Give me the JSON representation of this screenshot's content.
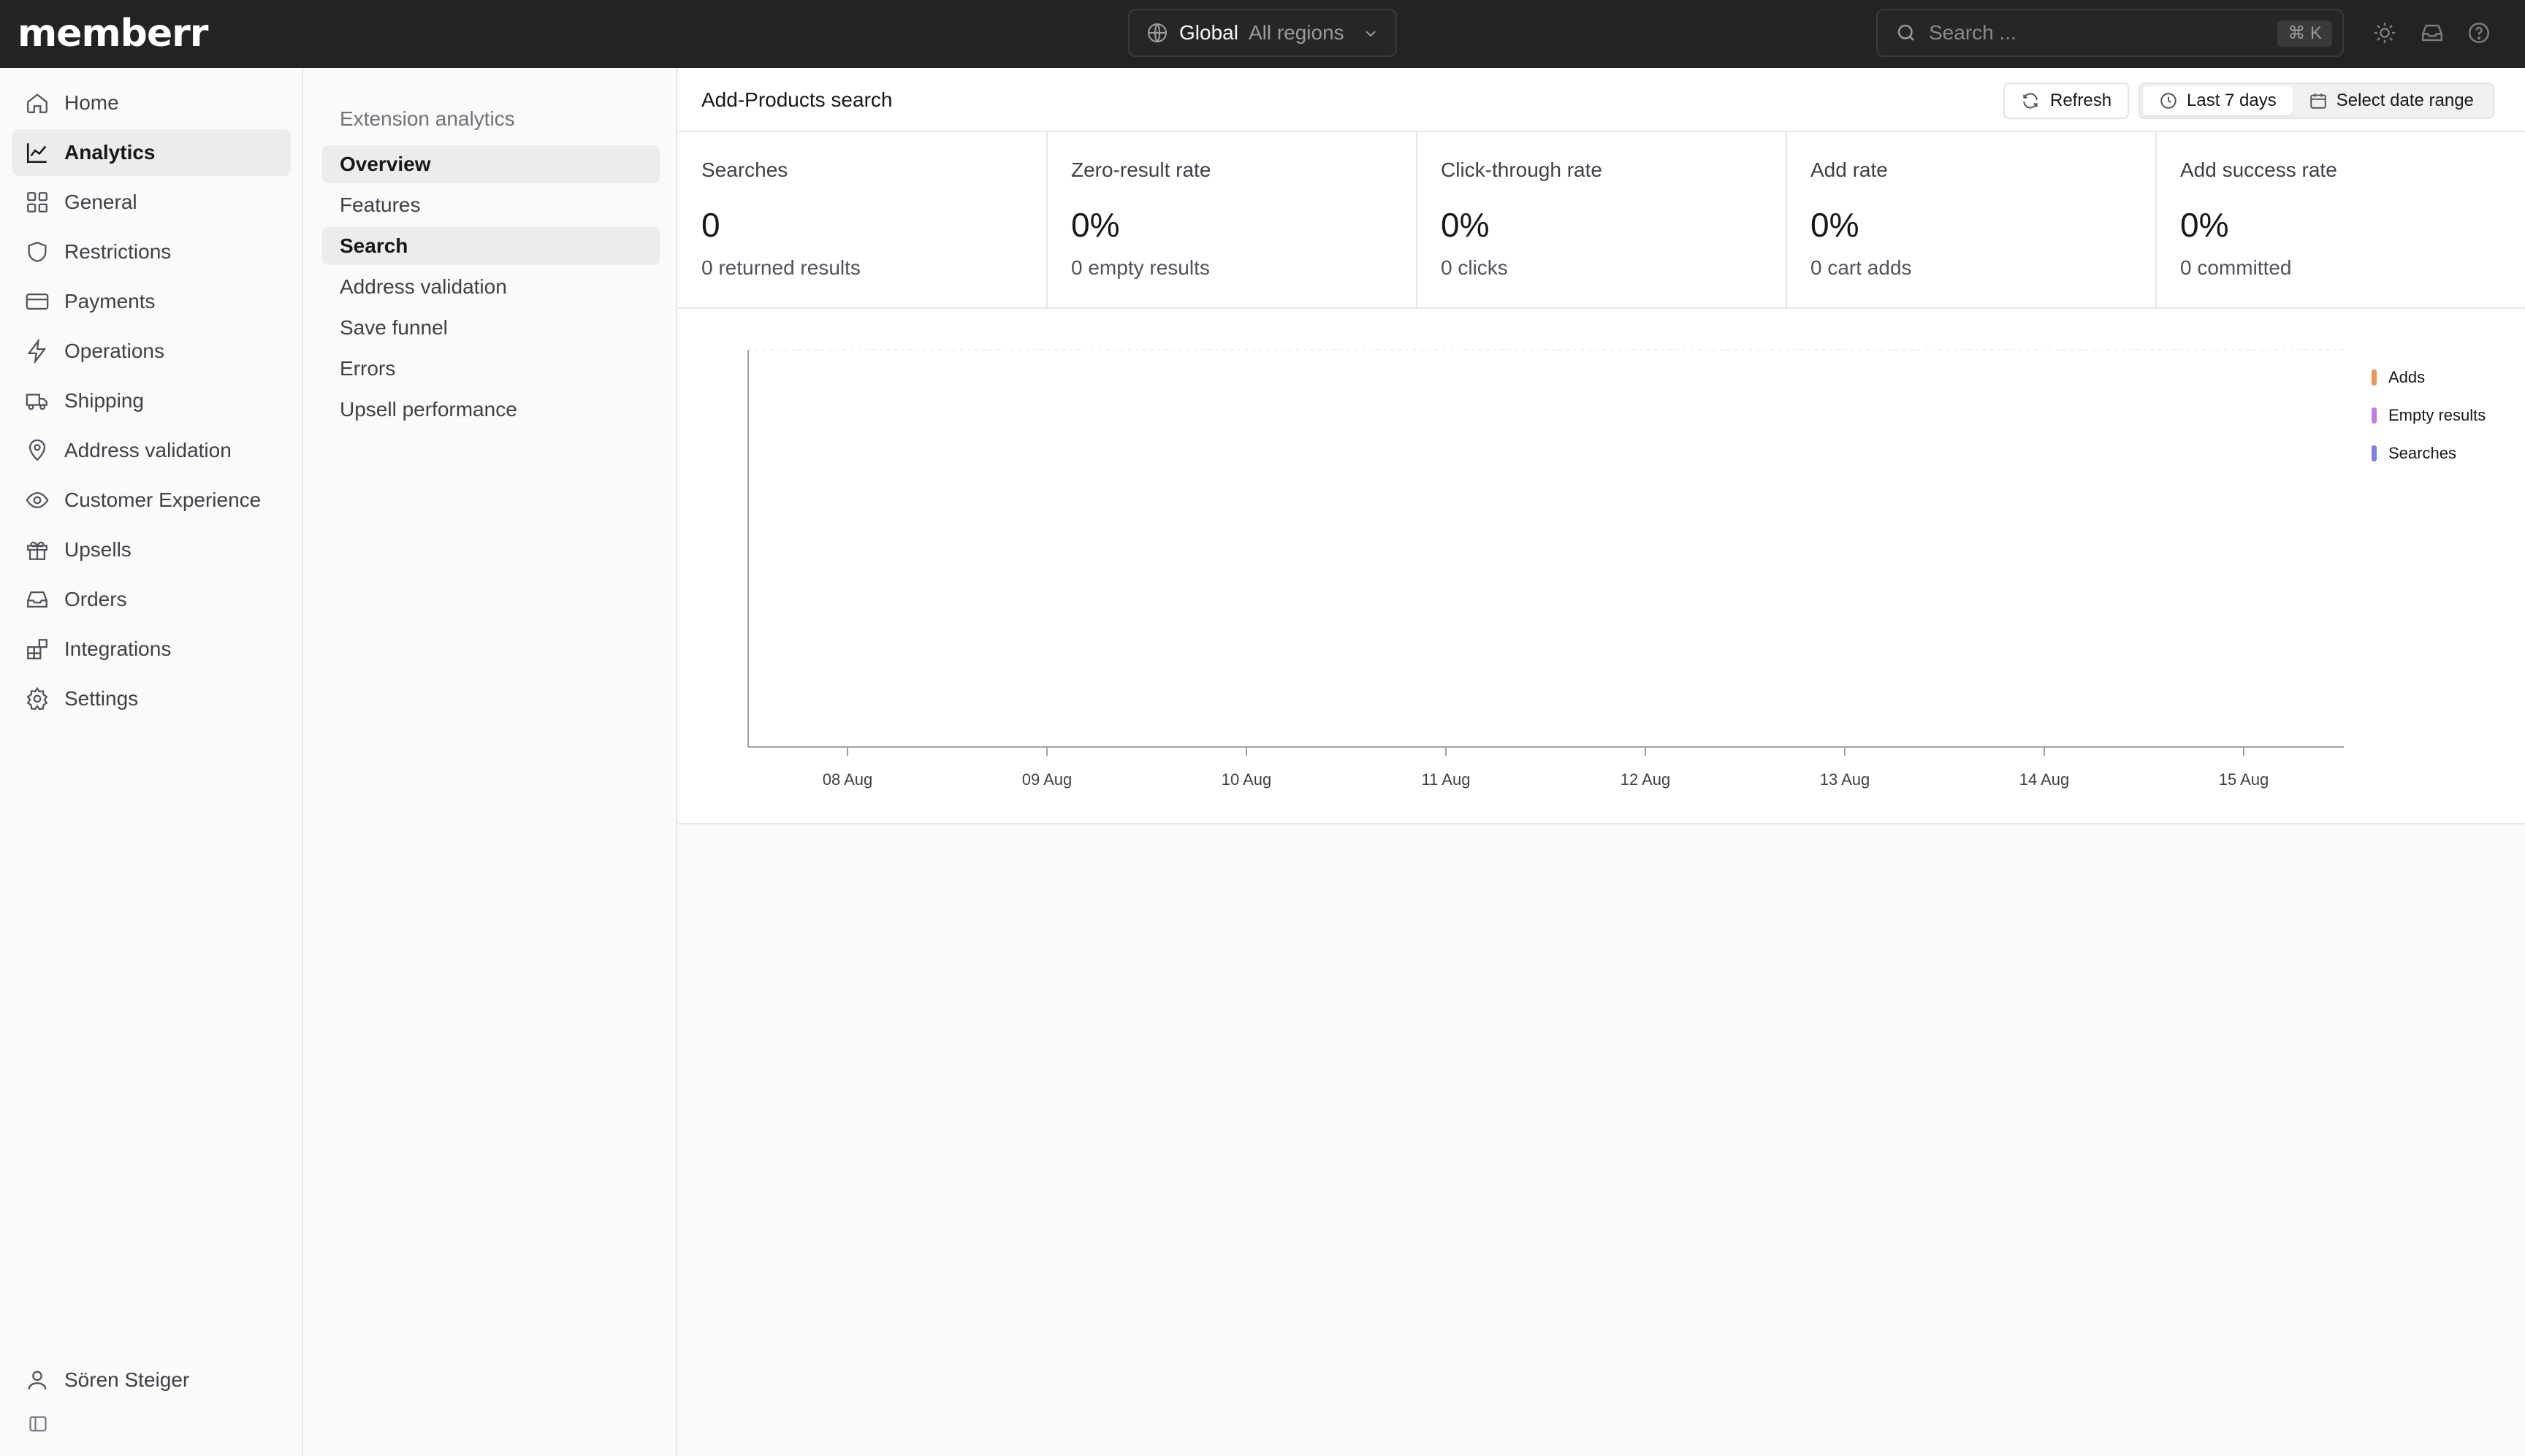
{
  "app": {
    "logo": "memberr",
    "region": {
      "name": "Global",
      "sub": "All regions"
    },
    "search": {
      "placeholder": "Search ...",
      "shortcut": "⌘ K"
    }
  },
  "sidebar": {
    "items": [
      {
        "label": "Home",
        "icon": "home-icon"
      },
      {
        "label": "Analytics",
        "icon": "chart-line-icon",
        "active": true
      },
      {
        "label": "General",
        "icon": "grid-icon"
      },
      {
        "label": "Restrictions",
        "icon": "shield-icon"
      },
      {
        "label": "Payments",
        "icon": "credit-card-icon"
      },
      {
        "label": "Operations",
        "icon": "lightning-icon"
      },
      {
        "label": "Shipping",
        "icon": "truck-icon"
      },
      {
        "label": "Address validation",
        "icon": "map-pin-icon"
      },
      {
        "label": "Customer Experience",
        "icon": "eye-icon"
      },
      {
        "label": "Upsells",
        "icon": "gift-icon"
      },
      {
        "label": "Orders",
        "icon": "inbox-icon"
      },
      {
        "label": "Integrations",
        "icon": "blocks-icon"
      },
      {
        "label": "Settings",
        "icon": "gear-icon"
      }
    ],
    "user": "Sören Steiger"
  },
  "subnav": {
    "title": "Extension analytics",
    "items": [
      {
        "label": "Overview"
      },
      {
        "label": "Features"
      },
      {
        "label": "Search"
      },
      {
        "label": "Address validation"
      },
      {
        "label": "Save funnel"
      },
      {
        "label": "Errors"
      },
      {
        "label": "Upsell performance"
      }
    ]
  },
  "main": {
    "title": "Add-Products search",
    "refresh_label": "Refresh",
    "range_options": [
      "Last 7 days",
      "Select date range"
    ],
    "stats": [
      {
        "label": "Searches",
        "value": "0",
        "sub": "0 returned results"
      },
      {
        "label": "Zero-result rate",
        "value": "0%",
        "sub": "0 empty results"
      },
      {
        "label": "Click-through rate",
        "value": "0%",
        "sub": "0 clicks"
      },
      {
        "label": "Add rate",
        "value": "0%",
        "sub": "0 cart adds"
      },
      {
        "label": "Add success rate",
        "value": "0%",
        "sub": "0 committed"
      }
    ]
  },
  "chart_data": {
    "type": "line",
    "categories": [
      "08 Aug",
      "09 Aug",
      "10 Aug",
      "11 Aug",
      "12 Aug",
      "13 Aug",
      "14 Aug",
      "15 Aug"
    ],
    "series": [
      {
        "name": "Adds",
        "color": "#f0955a",
        "values": []
      },
      {
        "name": "Empty results",
        "color": "#b97fe6",
        "values": []
      },
      {
        "name": "Searches",
        "color": "#7b7fe8",
        "values": []
      }
    ],
    "legend": "top-right",
    "grid": false
  }
}
